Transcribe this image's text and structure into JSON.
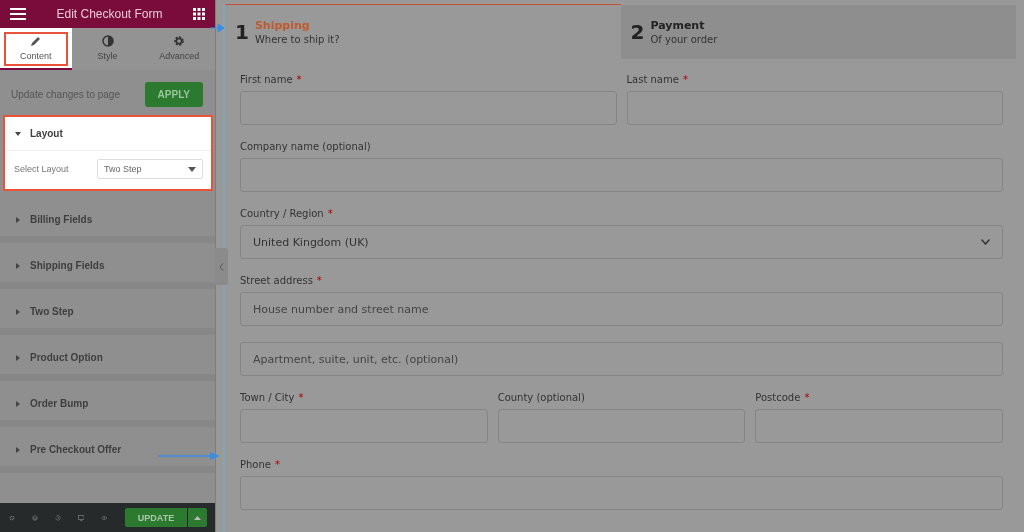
{
  "panel": {
    "title": "Edit Checkout Form",
    "tabs": [
      {
        "label": "Content",
        "selected": true
      },
      {
        "label": "Style",
        "selected": false
      },
      {
        "label": "Advanced",
        "selected": false
      }
    ],
    "apply": {
      "text": "Update changes to page",
      "button": "APPLY"
    },
    "sections": [
      {
        "title": "Layout",
        "expanded": true,
        "control": {
          "label": "Select Layout",
          "value": "Two Step"
        }
      },
      {
        "title": "Billing Fields",
        "expanded": false
      },
      {
        "title": "Shipping Fields",
        "expanded": false
      },
      {
        "title": "Two Step",
        "expanded": false
      },
      {
        "title": "Product Option",
        "expanded": false
      },
      {
        "title": "Order Bump",
        "expanded": false
      },
      {
        "title": "Pre Checkout Offer",
        "expanded": false
      }
    ],
    "footer": {
      "button": "UPDATE"
    }
  },
  "steps": [
    {
      "number": "1",
      "title": "Shipping",
      "subtitle": "Where to ship it?",
      "selected": true
    },
    {
      "number": "2",
      "title": "Payment",
      "subtitle": "Of your order",
      "selected": false
    }
  ],
  "form": {
    "rows": [
      [
        {
          "label": "First name",
          "required_mark": "*",
          "kind": "input"
        },
        {
          "label": "Last name",
          "required_mark": "*",
          "kind": "input"
        }
      ],
      [
        {
          "label": "Company name (optional)",
          "kind": "input"
        }
      ],
      [
        {
          "label": "Country / Region",
          "required_mark": "*",
          "kind": "select",
          "value": "United Kingdom (UK)"
        }
      ],
      [
        {
          "label": "Street address",
          "required_mark": "*",
          "kind": "input",
          "placeholder": "House number and street name"
        }
      ],
      [
        {
          "kind": "input",
          "placeholder": "Apartment, suite, unit, etc. (optional)"
        }
      ],
      [
        {
          "label": "Town / City",
          "required_mark": "*",
          "kind": "input"
        },
        {
          "label": "County (optional)",
          "kind": "input"
        },
        {
          "label": "Postcode",
          "required_mark": "*",
          "kind": "input"
        }
      ],
      [
        {
          "label": "Phone",
          "required_mark": "*",
          "kind": "input"
        }
      ]
    ]
  }
}
